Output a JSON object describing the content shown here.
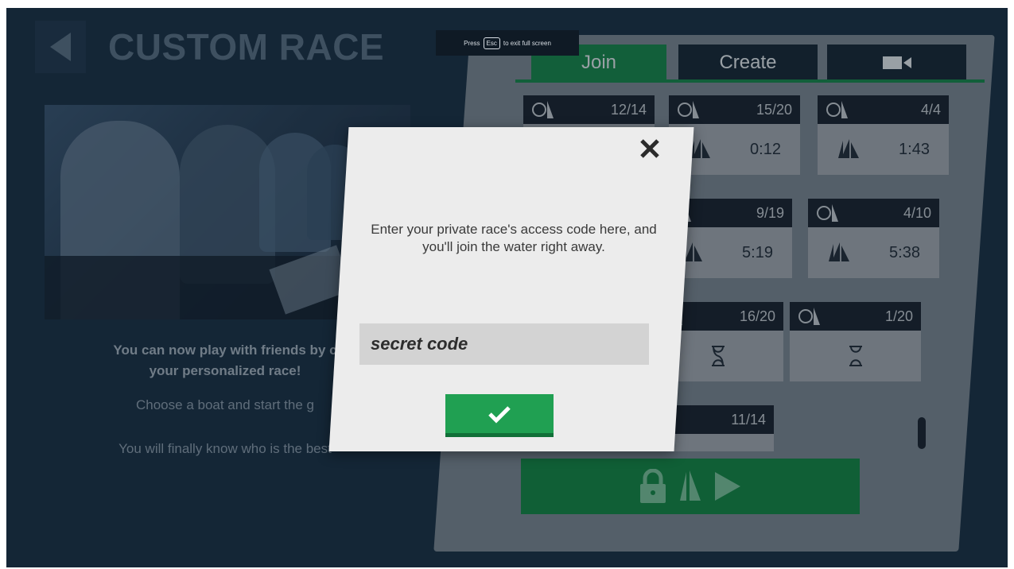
{
  "header": {
    "title": "CUSTOM RACE",
    "back_icon": "back-arrow-icon"
  },
  "fullscreen_hint": {
    "pre": "Press",
    "key": "Esc",
    "post": "to exit full screen"
  },
  "info": {
    "line1": "You can now play with friends by c",
    "line2": "your personalized race!",
    "line3": "Choose a boat and start the g",
    "line4": "You will finally know who is the best"
  },
  "tabs": {
    "join": "Join",
    "create": "Create",
    "video_icon": "video-camera-icon"
  },
  "races": [
    {
      "players": "12/14",
      "time": ""
    },
    {
      "players": "15/20",
      "time": "0:12"
    },
    {
      "players": "4/4",
      "time": "1:43"
    },
    {
      "players": "9/19",
      "time": "5:19"
    },
    {
      "players": "4/10",
      "time": "5:38"
    },
    {
      "players": "16/20",
      "time": ""
    },
    {
      "players": "1/20",
      "time": ""
    },
    {
      "players": "11/14",
      "time": ""
    }
  ],
  "modal": {
    "message": "Enter your private race's access code here, and you'll join the water right away.",
    "input_placeholder": "secret code",
    "confirm_icon": "checkmark-icon",
    "close_icon": "close-icon"
  },
  "colors": {
    "accent": "#1a8a4d",
    "dark": "#1c2632",
    "modal_bg": "#ececec"
  }
}
